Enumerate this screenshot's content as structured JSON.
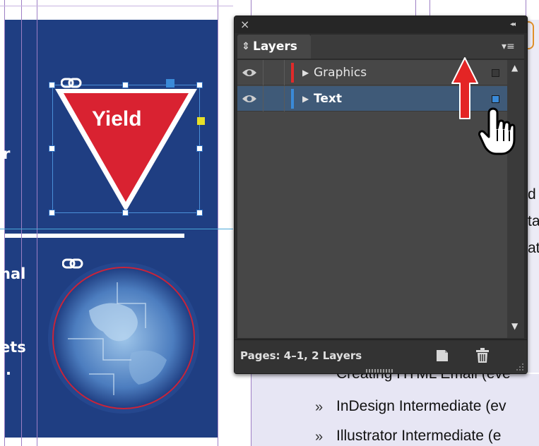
{
  "document": {
    "yield_sign_text": "Yield",
    "partial_text_left": [
      "r",
      "nal",
      "ets",
      "."
    ],
    "partial_text_right": [
      "d",
      "ta",
      "at"
    ],
    "bullet_marker": "»",
    "list_items": [
      "Creating HTML Email (eve",
      "InDesign Intermediate (ev",
      "Illustrator Intermediate (e"
    ],
    "colors": {
      "page_blue": "#1f3e82",
      "yield_red": "#d92231",
      "guide_purple": "#9d7fc4",
      "guide_cyan": "#4aa7d8"
    }
  },
  "layers_panel": {
    "close_glyph": "×",
    "collapse_glyph": "◂◂",
    "tab_label": "Layers",
    "tab_arrows": "⇕",
    "menu_glyph": "▾≡",
    "layers": [
      {
        "name": "Graphics",
        "color": "#e02a2a",
        "visible": true,
        "selected": false
      },
      {
        "name": "Text",
        "color": "#3a8ad8",
        "visible": true,
        "selected": true
      }
    ],
    "status_text": "Pages: 4–1, 2 Layers",
    "scroll_up_glyph": "▲",
    "scroll_down_glyph": "▼",
    "annotation_arrow_color": "#e42525"
  }
}
